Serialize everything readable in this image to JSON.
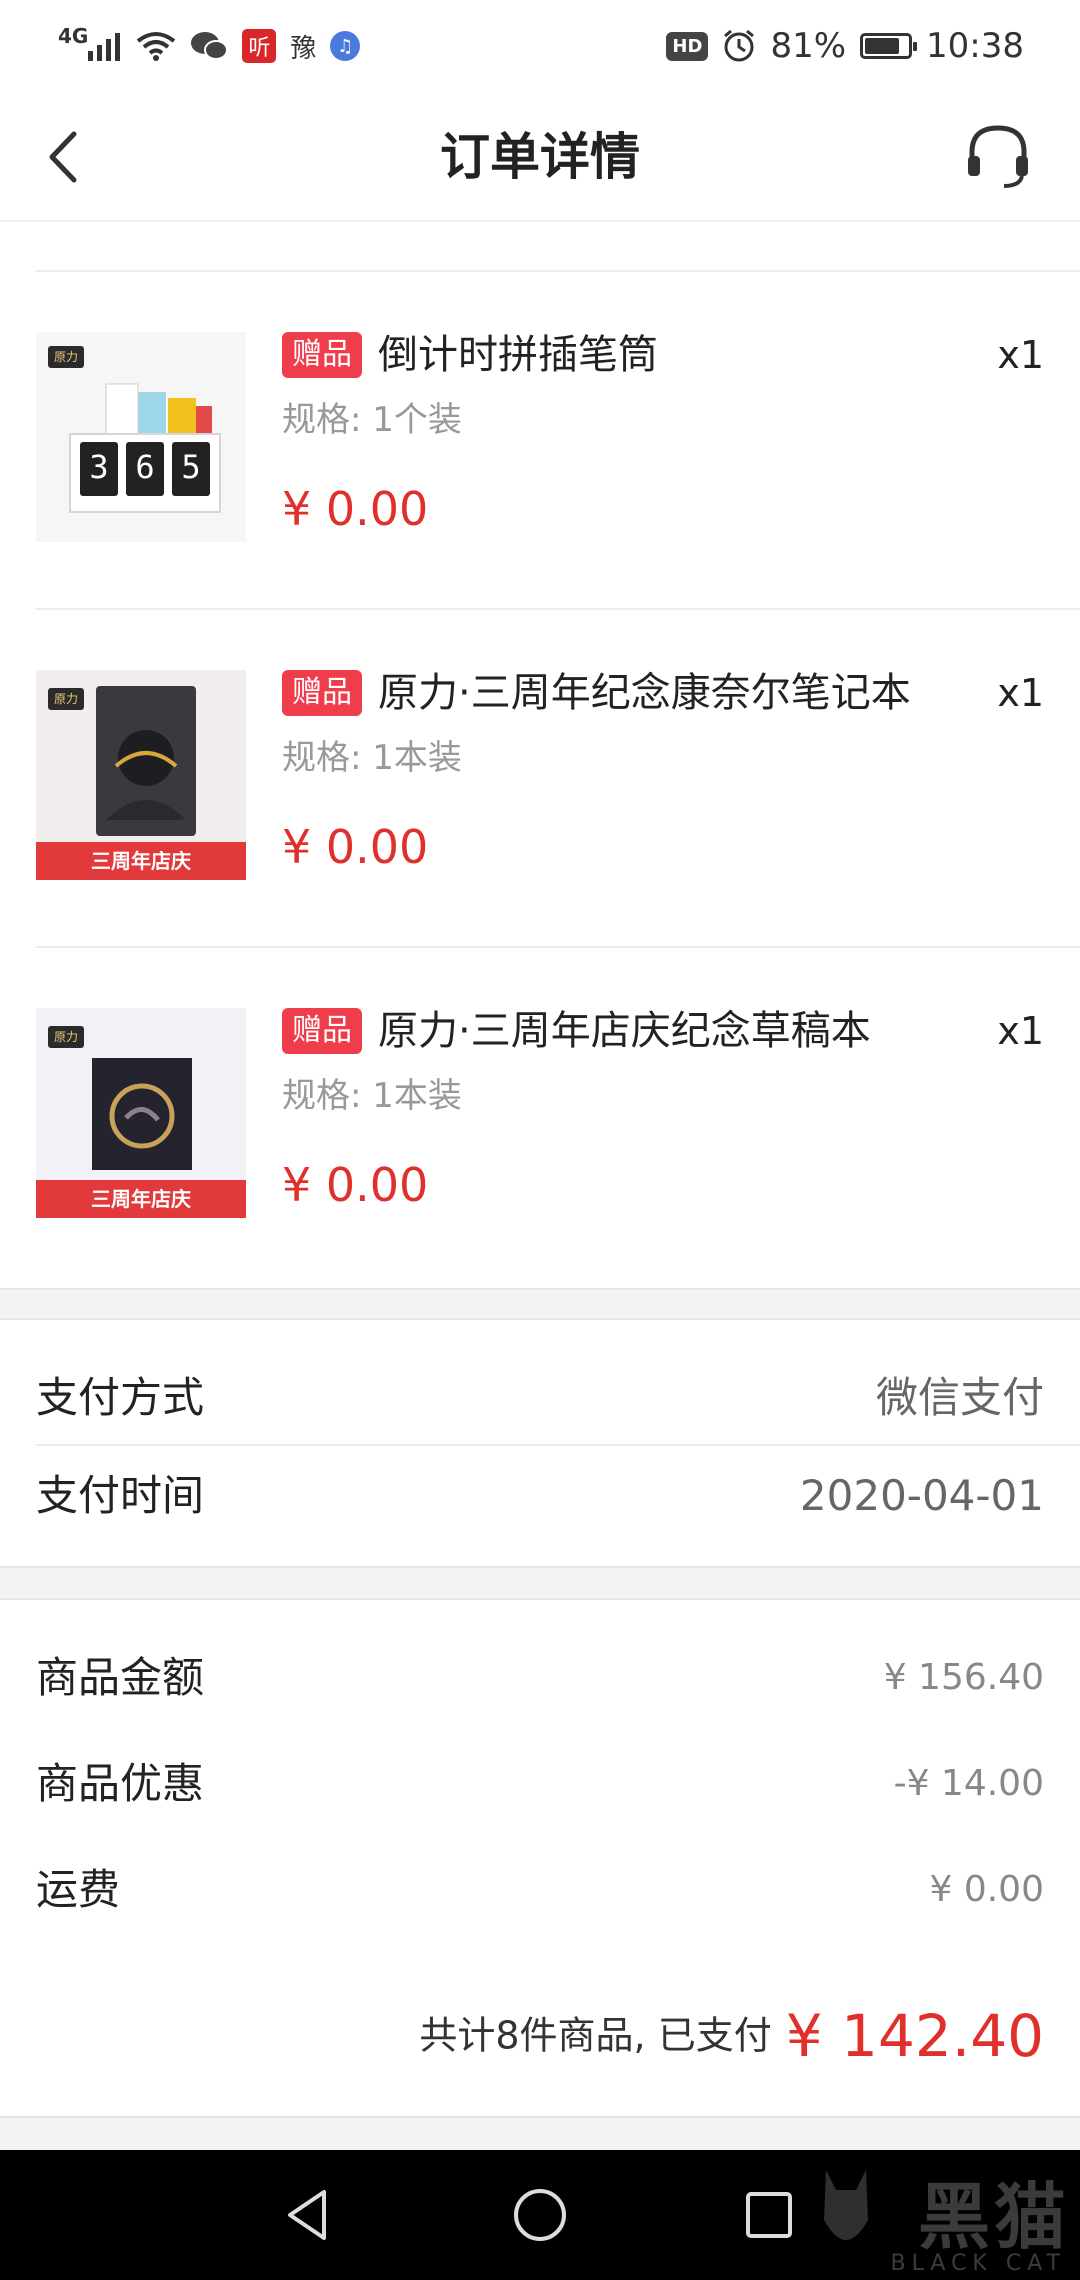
{
  "status_bar": {
    "network": "4G",
    "app_listen": "听",
    "app_misc": "豫",
    "music_glyph": "♫",
    "hd": "HD",
    "battery_percent": "81%",
    "battery_level": 0.81,
    "time": "10:38"
  },
  "nav": {
    "title": "订单详情",
    "back_icon": "chevron-left-icon",
    "service_icon": "headset-icon"
  },
  "products": [
    {
      "tag": "赠品",
      "name": "倒计时拼插笔筒",
      "qty": "x1",
      "spec": "规格: 1个装",
      "price": "¥ 0.00",
      "thumb_brand": "原力",
      "thumb_digits": [
        "3",
        "6",
        "5"
      ],
      "thumb_banner": ""
    },
    {
      "tag": "赠品",
      "name": "原力·三周年纪念康奈尔笔记本",
      "qty": "x1",
      "spec": "规格: 1本装",
      "price": "¥ 0.00",
      "thumb_brand": "原力",
      "thumb_banner": "三周年店庆"
    },
    {
      "tag": "赠品",
      "name": "原力·三周年店庆纪念草稿本",
      "qty": "x1",
      "spec": "规格: 1本装",
      "price": "¥ 0.00",
      "thumb_brand": "原力",
      "thumb_banner": "三周年店庆"
    }
  ],
  "payment": {
    "method_label": "支付方式",
    "method_value": "微信支付",
    "time_label": "支付时间",
    "time_value": "2020-04-01"
  },
  "amounts": {
    "goods_label": "商品金额",
    "goods_value": "¥ 156.40",
    "discount_label": "商品优惠",
    "discount_value": "-¥ 14.00",
    "shipping_label": "运费",
    "shipping_value": "¥ 0.00",
    "total_text": "共计8件商品, 已支付",
    "total_amount": "¥ 142.40"
  },
  "watermark": {
    "cn": "黑猫",
    "en": "BLACK CAT"
  },
  "colors": {
    "accent_red": "#e0302c",
    "tag_red": "#ef3d4c",
    "muted_gray": "#999999"
  }
}
